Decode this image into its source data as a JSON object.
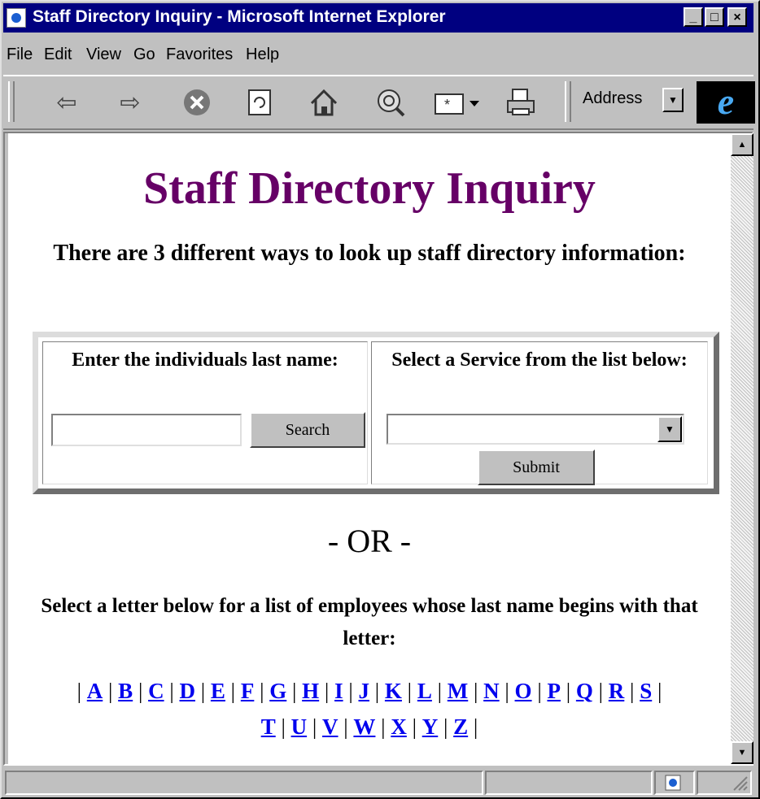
{
  "window": {
    "title": "Staff Directory Inquiry - Microsoft Internet Explorer"
  },
  "menu": [
    "File",
    "Edit",
    "View",
    "Go",
    "Favorites",
    "Help"
  ],
  "toolbar": {
    "icons": [
      "back-icon",
      "forward-icon",
      "stop-icon",
      "refresh-icon",
      "home-icon",
      "search-icon",
      "favorites-icon",
      "print-icon"
    ],
    "address_label": "Address",
    "brand": "e"
  },
  "page": {
    "title": "Staff Directory Inquiry",
    "intro": "There are 3 different ways to look up staff directory information:",
    "lastname_label": "Enter the individuals last name:",
    "lastname_value": "",
    "search_button": "Search",
    "service_label": "Select a Service from the list below:",
    "service_selected": "",
    "submit_button": "Submit",
    "or_text": "- OR -",
    "letter_instructions": "Select a letter below for a list of employees whose last name begins with that letter:",
    "letters": [
      "A",
      "B",
      "C",
      "D",
      "E",
      "F",
      "G",
      "H",
      "I",
      "J",
      "K",
      "L",
      "M",
      "N",
      "O",
      "P",
      "Q",
      "R",
      "S",
      "T",
      "U",
      "V",
      "W",
      "X",
      "Y",
      "Z"
    ]
  },
  "colors": {
    "title": "#660066",
    "link": "#0000ee",
    "titlebar": "#000080"
  }
}
